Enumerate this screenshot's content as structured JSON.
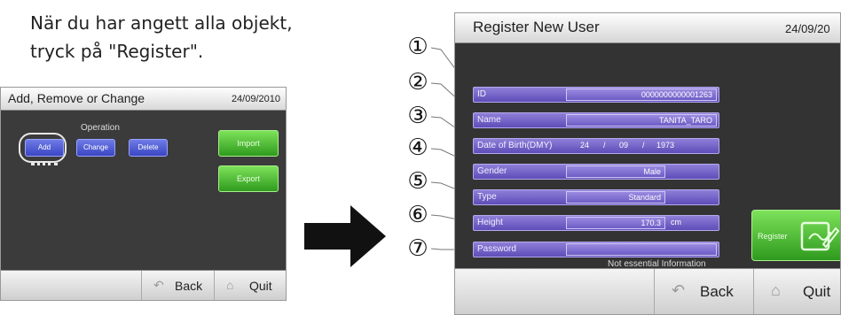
{
  "instruction": {
    "line1": "När du har angett alla objekt,",
    "line2": "tryck på \"Register\"."
  },
  "small_screen": {
    "title": "Add, Remove or Change",
    "date": "24/09/2010",
    "operation_label": "Operation",
    "buttons": {
      "add": "Add",
      "change": "Change",
      "delete": "Delete",
      "import": "Import",
      "export": "Export"
    },
    "footer": {
      "back": "Back",
      "quit": "Quit"
    }
  },
  "big_screen": {
    "title": "Register New User",
    "date": "24/09/20",
    "fields": {
      "id": {
        "label": "ID",
        "value": "0000000000001263"
      },
      "name": {
        "label": "Name",
        "value": "TANITA_TARO"
      },
      "dob": {
        "label": "Date of Birth(DMY)",
        "day": "24",
        "month": "09",
        "year": "1973",
        "sep": "/"
      },
      "gender": {
        "label": "Gender",
        "value": "Male"
      },
      "type": {
        "label": "Type",
        "value": "Standard"
      },
      "height": {
        "label": "Height",
        "value": "170.3",
        "unit": "cm"
      },
      "password": {
        "label": "Password",
        "value": ""
      }
    },
    "note": "Not essential Information",
    "register_label": "Register",
    "footer": {
      "back": "Back",
      "quit": "Quit"
    }
  },
  "callouts": [
    "①",
    "②",
    "③",
    "④",
    "⑤",
    "⑥",
    "⑦"
  ],
  "icons": {
    "back": "back-arrow-icon",
    "quit": "house-icon",
    "register": "register-pen-icon",
    "arrow": "right-arrow-icon"
  },
  "colors": {
    "field_purple": "#7463cc",
    "button_green": "#4cbf35",
    "button_blue": "#4b56d6",
    "screen_bg": "#333333"
  }
}
